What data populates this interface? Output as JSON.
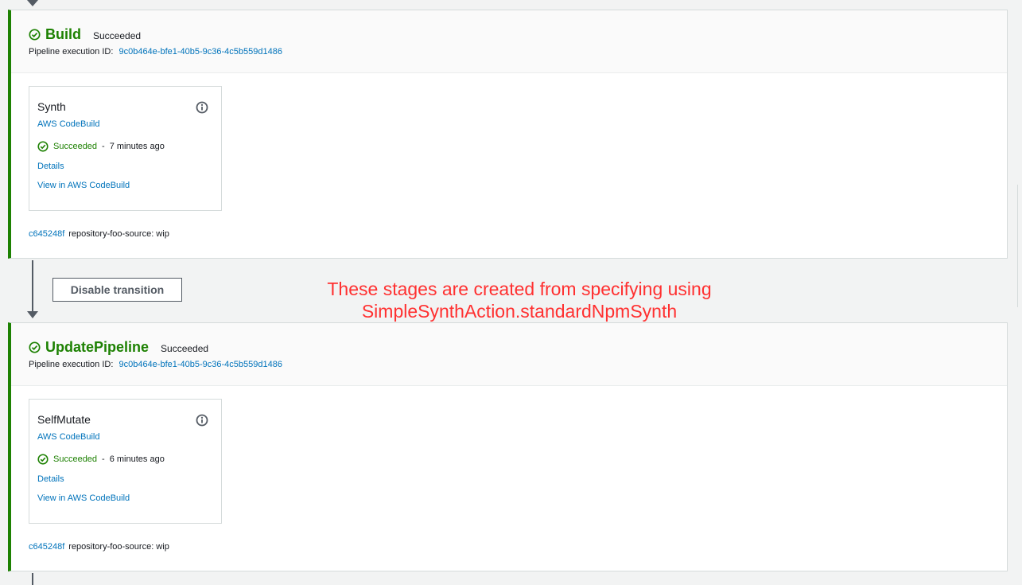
{
  "stages": [
    {
      "name": "Build",
      "status": "Succeeded",
      "exec_label": "Pipeline execution ID:",
      "exec_id": "9c0b464e-bfe1-40b5-9c36-4c5b559d1486",
      "action": {
        "name": "Synth",
        "provider": "AWS CodeBuild",
        "status": "Succeeded",
        "time": "7 minutes ago",
        "details": "Details",
        "view": "View in AWS CodeBuild"
      },
      "source": {
        "commit": "c645248f",
        "message": "repository-foo-source: wip"
      }
    },
    {
      "name": "UpdatePipeline",
      "status": "Succeeded",
      "exec_label": "Pipeline execution ID:",
      "exec_id": "9c0b464e-bfe1-40b5-9c36-4c5b559d1486",
      "action": {
        "name": "SelfMutate",
        "provider": "AWS CodeBuild",
        "status": "Succeeded",
        "time": "6 minutes ago",
        "details": "Details",
        "view": "View in AWS CodeBuild"
      },
      "source": {
        "commit": "c645248f",
        "message": "repository-foo-source: wip"
      }
    }
  ],
  "transition_button": "Disable transition",
  "annotation": {
    "line1": "These stages are created from specifying using",
    "line2": "SimpleSynthAction.standardNpmSynth"
  },
  "icons": {
    "status": "check-circle-icon",
    "info": "info-icon",
    "flow": "arrow-down-icon"
  },
  "colors": {
    "success": "#1d8102",
    "link": "#0073bb",
    "annotation": "#ff3030"
  }
}
